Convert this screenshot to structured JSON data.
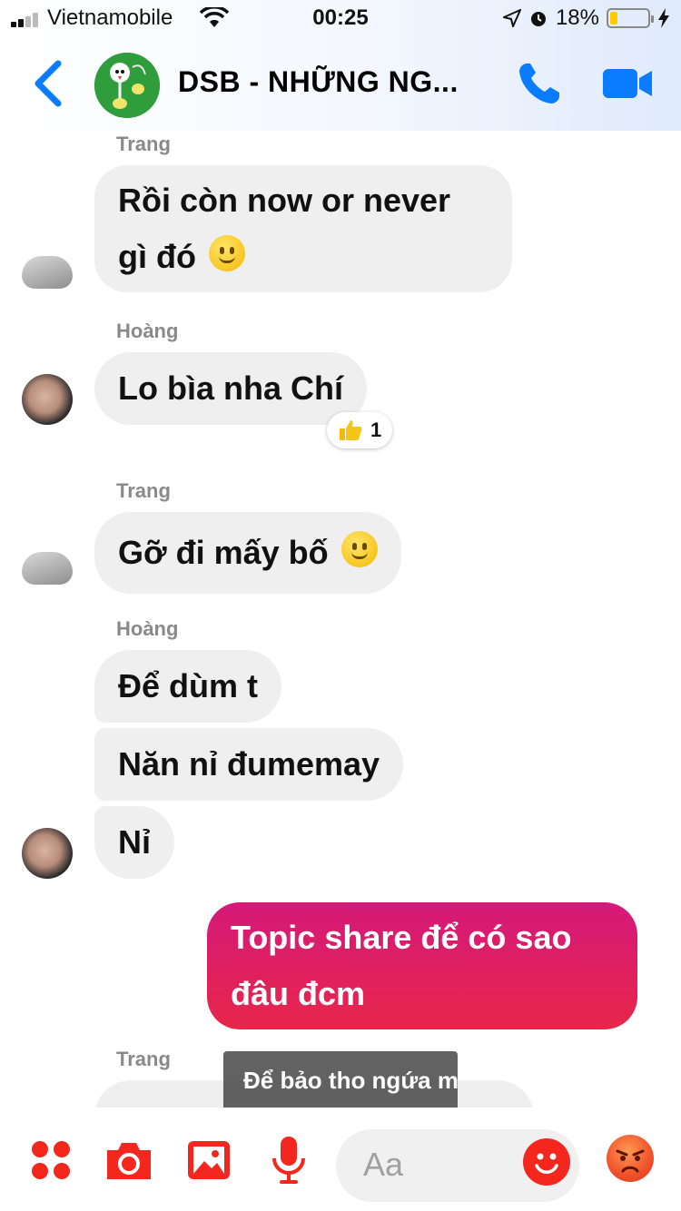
{
  "status_bar": {
    "carrier": "Vietnamobile",
    "time": "00:25",
    "battery": "18%",
    "battery_level": 0.18
  },
  "header": {
    "title": "DSB - NHỮNG NG..."
  },
  "messages": [
    {
      "sender": "Trang",
      "text_lines": [
        "Rồi còn now or never",
        "gì đó"
      ],
      "emoji": "slightly-smiling-face"
    },
    {
      "sender": "Hoàng",
      "text": "Lo bìa nha Chí",
      "reaction": {
        "icon": "thumbs-up",
        "count": "1"
      }
    },
    {
      "sender": "Trang",
      "text": "Gỡ đi mấy bố",
      "emoji": "slightly-smiling-face"
    },
    {
      "sender": "Hoàng",
      "texts": [
        "Để dùm t",
        "Năn nỉ đumemay",
        "Nỉ"
      ]
    },
    {
      "sender": "me",
      "text_lines": [
        "Topic share để có sao",
        "đâu đcm"
      ]
    },
    {
      "sender": "Trang",
      "text": ""
    }
  ],
  "toast": {
    "text": "Để bảo tho ngứa mat"
  },
  "composer": {
    "placeholder": "Aa"
  },
  "colors": {
    "accent": "#0a7cff",
    "tool_red": "#f4271f",
    "bubble_gray": "#efefef",
    "mine_top": "#d4197a",
    "mine_bottom": "#e8264a"
  }
}
